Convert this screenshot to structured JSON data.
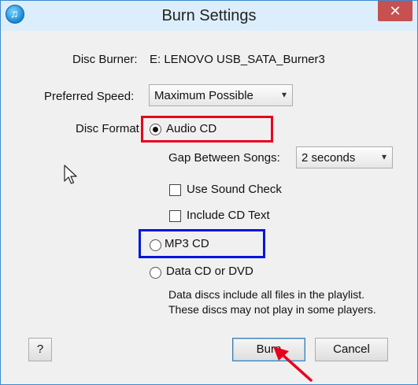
{
  "window": {
    "title": "Burn Settings",
    "close_glyph": "✕"
  },
  "disc_burner": {
    "label": "Disc Burner:",
    "value": "E: LENOVO USB_SATA_Burner3"
  },
  "preferred_speed": {
    "label": "Preferred Speed:",
    "selected": "Maximum Possible"
  },
  "disc_format": {
    "label": "Disc Format",
    "options": [
      {
        "label": "Audio CD",
        "checked": true
      },
      {
        "label": "MP3 CD",
        "checked": false
      },
      {
        "label": "Data CD or DVD",
        "checked": false
      }
    ]
  },
  "audio_cd": {
    "gap_label": "Gap Between Songs:",
    "gap_selected": "2 seconds",
    "use_sound_check": {
      "label": "Use Sound Check",
      "checked": false
    },
    "include_cd_text": {
      "label": "Include CD Text",
      "checked": false
    }
  },
  "data_note": {
    "line1": "Data discs include all files in the playlist.",
    "line2": "These discs may not play in some players."
  },
  "buttons": {
    "help": "?",
    "burn": "Burn",
    "cancel": "Cancel"
  },
  "annotation_colors": {
    "audio_cd_box": "#e8001c",
    "mp3_cd_box": "#0015e0",
    "arrow": "#e8001c"
  },
  "icons": {
    "app": "itunes-icon",
    "close": "close-icon",
    "chevron": "chevron-down-icon",
    "cursor": "mouse-pointer-icon",
    "arrow": "red-arrow-icon"
  }
}
